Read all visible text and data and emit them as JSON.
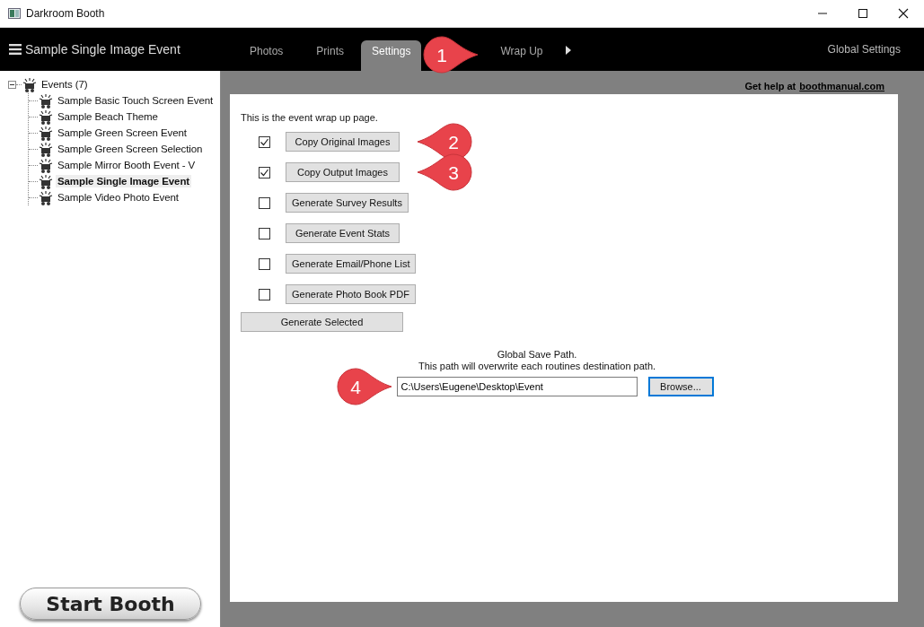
{
  "window": {
    "title": "Darkroom Booth"
  },
  "header": {
    "event_title": "Sample Single Image Event",
    "tabs": [
      {
        "label": "Photos",
        "selected": false
      },
      {
        "label": "Prints",
        "selected": false
      },
      {
        "label": "Settings",
        "selected": true,
        "callout": "1"
      },
      {
        "label": "Wrap Up",
        "selected": false
      }
    ],
    "global_settings": "Global Settings"
  },
  "sidebar": {
    "tree": {
      "label": "Events (7)",
      "expanded": true,
      "children": [
        {
          "label": "Sample Basic Touch Screen Event",
          "selected": false
        },
        {
          "label": "Sample Beach Theme",
          "selected": false
        },
        {
          "label": "Sample Green Screen Event",
          "selected": false
        },
        {
          "label": "Sample Green Screen Selection",
          "selected": false
        },
        {
          "label": "Sample Mirror Booth Event - V",
          "selected": false
        },
        {
          "label": "Sample Single Image Event",
          "selected": true
        },
        {
          "label": "Sample Video Photo Event",
          "selected": false
        }
      ]
    },
    "start_button": "Start Booth"
  },
  "main": {
    "help_prefix": "Get help at",
    "help_link": "boothmanual.com",
    "intro": "This is the event wrap up page.",
    "actions": [
      {
        "label": "Copy Original Images",
        "checked": true,
        "callout": "2"
      },
      {
        "label": "Copy Output Images",
        "checked": true,
        "callout": "3"
      },
      {
        "label": "Generate Survey Results",
        "checked": false
      },
      {
        "label": "Generate Event Stats",
        "checked": false
      },
      {
        "label": "Generate Email/Phone List",
        "checked": false
      },
      {
        "label": "Generate Photo Book PDF",
        "checked": false
      }
    ],
    "generate_button": "Generate Selected",
    "save_path": {
      "title": "Global Save Path.",
      "note": "This path will overwrite each routines destination path.",
      "value": "C:\\Users\\Eugene\\Desktop\\Event",
      "browse": "Browse...",
      "callout": "4"
    }
  }
}
